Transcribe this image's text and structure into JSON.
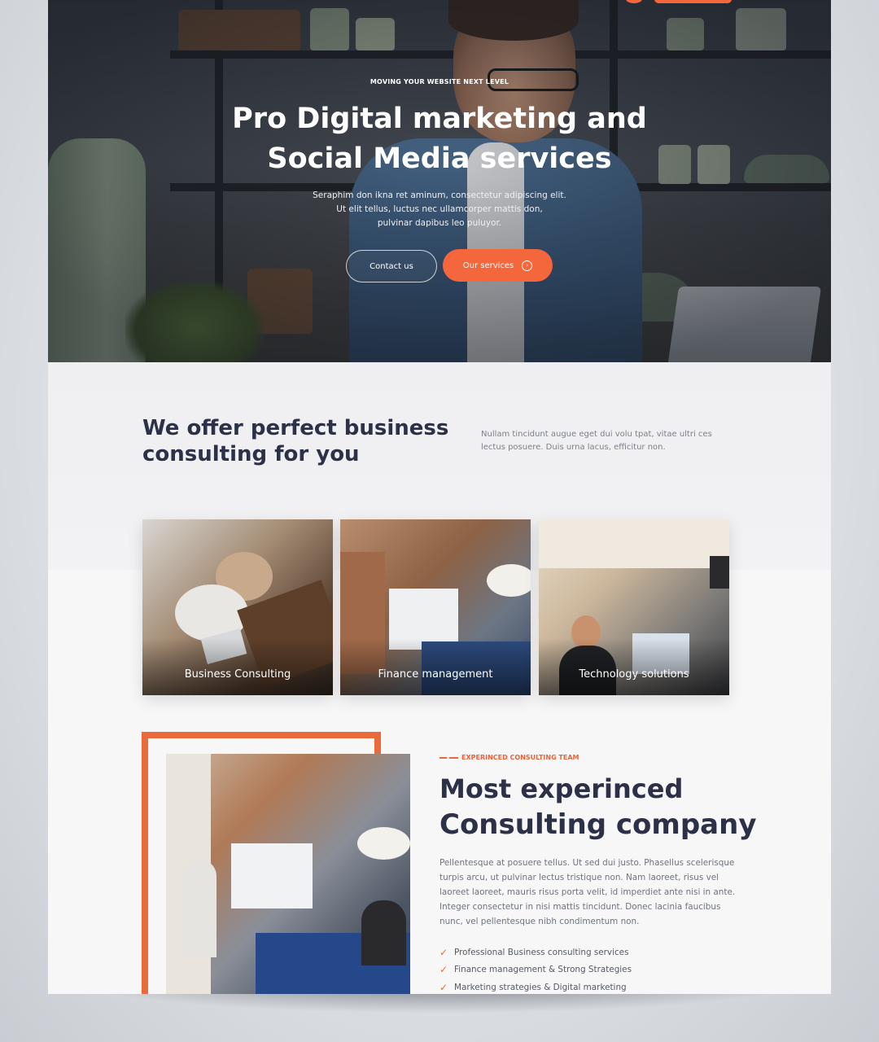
{
  "hero": {
    "eyebrow": "MOVING YOUR WEBSITE NEXT LEVEL",
    "title_line1": "Pro Digital marketing and",
    "title_line2": "Social Media services",
    "text_line1": "Seraphim don ikna ret aminum, consectetur adipiscing elit.",
    "text_line2": "Ut elit tellus, luctus nec ullamcorper mattis don,",
    "text_line3": "pulvinar dapibus leo puluyor.",
    "contact_label": "Contact us",
    "services_label": "Our services"
  },
  "offer": {
    "title_line1": "We offer perfect business",
    "title_line2": "consulting for you",
    "text": "Nullam tincidunt augue eget dui volu tpat, vitae ultri ces lectus posuere. Duis urna lacus, efficitur non."
  },
  "cards": [
    {
      "caption": "Business Consulting"
    },
    {
      "caption": "Finance management"
    },
    {
      "caption": "Technology solutions"
    }
  ],
  "about": {
    "eyebrow": "EXPERINCED CONSULTING TEAM",
    "title_bold": "Most experinced",
    "title_light": "Consulting company",
    "text": "Pellentesque at posuere tellus. Ut sed dui justo. Phasellus scelerisque turpis arcu, ut pulvinar lectus tristique non. Nam laoreet, risus vel laoreet laoreet, mauris risus porta velit, id imperdiet ante nisi in ante. Integer consectetur in nisi mattis tincidunt. Donec lacinia faucibus nunc, vel pellentesque nibh condimentum non.",
    "checks": [
      "Professional Business consulting services",
      "Finance management & Strong Strategies",
      "Marketing strategies & Digital marketing"
    ]
  },
  "colors": {
    "accent": "#f4673c",
    "heading": "#2c3148",
    "body_text": "#6e7380"
  },
  "icons": {
    "button_arrow": "arrow-right-circle-icon",
    "check": "check-icon"
  }
}
